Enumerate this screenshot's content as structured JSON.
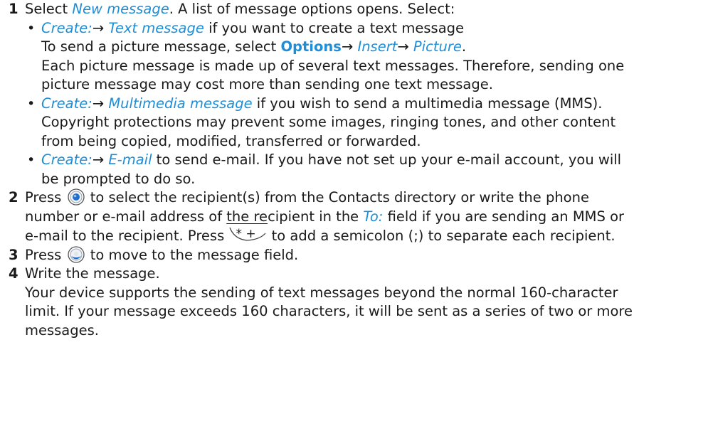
{
  "step1": {
    "num": "1",
    "t1": "Select ",
    "link1": "New message",
    "t2": ". A list of message options opens. Select:",
    "b1": {
      "l1": "Create:",
      "arrow": "→",
      "l2": "Text message",
      "t1": " if you want to create a text message",
      "c1a": "To send a picture message, select ",
      "opt": "Options",
      "c1b": "→",
      "l3": "Insert",
      "c1c": "→",
      "l4": "Picture",
      "c1d": ".",
      "c2": "Each picture message is made up of several text messages. Therefore, sending one",
      "c3": "picture message may cost more than sending one text message."
    },
    "b2": {
      "l1": "Create:",
      "arrow": "→",
      "l2": "Multimedia message",
      "t1": " if you wish to send a multimedia message (MMS).",
      "c1": "Copyright protections may prevent some images, ringing tones, and other content",
      "c2": "from being copied, modified, transferred or forwarded."
    },
    "b3": {
      "l1": "Create:",
      "arrow": "→",
      "l2": "E-mail",
      "t1": " to send e-mail. If you have not set up your e-mail account, you will",
      "c1": "be prompted to do so."
    }
  },
  "step2": {
    "num": "2",
    "t1": "Press ",
    "t2": " to select the recipient(s) from the Contacts directory or write the phone",
    "c1a": "number or e-mail address of ",
    "c1b": "the re",
    "c1c": "cipient in the ",
    "link": "To:",
    "c1d": " field if you are sending an MMS or",
    "c2a": "e-mail to the recipient. Press ",
    "key_label": "* +",
    "c2b": " to add a semicolon (;) to separate each recipient."
  },
  "step3": {
    "num": "3",
    "t1": "Press ",
    "t2": " to move to the message field."
  },
  "step4": {
    "num": "4",
    "t1": "Write the message.",
    "c1": "Your device supports the sending of text messages beyond the normal 160-character",
    "c2": "limit. If your message exceeds 160 characters, it will be sent as a series of two or more",
    "c3": "messages."
  },
  "colors": {
    "link": "#1f8ed6",
    "text": "#1a1a1a",
    "key_blue": "#1f6fd0"
  },
  "icons": [
    "nav-key-select-icon",
    "star-plus-key-icon",
    "nav-key-down-icon"
  ]
}
